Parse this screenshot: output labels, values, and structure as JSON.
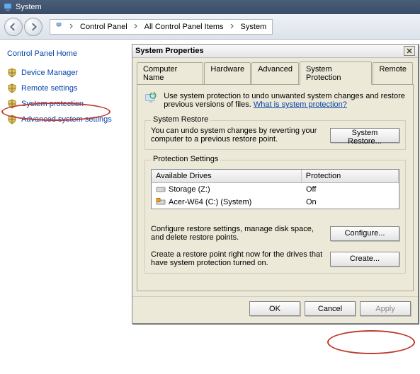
{
  "window": {
    "title": "System"
  },
  "breadcrumb": {
    "a": "Control Panel",
    "b": "All Control Panel Items",
    "c": "System"
  },
  "sidebar": {
    "home": "Control Panel Home",
    "items": [
      {
        "label": "Device Manager"
      },
      {
        "label": "Remote settings"
      },
      {
        "label": "System protection"
      },
      {
        "label": "Advanced system settings"
      }
    ]
  },
  "dialog": {
    "title": "System Properties",
    "tabs": {
      "t0": "Computer Name",
      "t1": "Hardware",
      "t2": "Advanced",
      "t3": "System Protection",
      "t4": "Remote"
    },
    "intro": {
      "text": "Use system protection to undo unwanted system changes and restore previous versions of files. ",
      "link": "What is system protection?"
    },
    "restore": {
      "legend": "System Restore",
      "text": "You can undo system changes by reverting your computer to a previous restore point.",
      "button": "System Restore..."
    },
    "protection": {
      "legend": "Protection Settings",
      "col_drives": "Available Drives",
      "col_protection": "Protection",
      "rows": [
        {
          "drive": "Storage (Z:)",
          "protection": "Off"
        },
        {
          "drive": "Acer-W64 (C:) (System)",
          "protection": "On"
        }
      ],
      "configure_text": "Configure restore settings, manage disk space, and delete restore points.",
      "configure_btn": "Configure...",
      "create_text": "Create a restore point right now for the drives that have system protection turned on.",
      "create_btn": "Create..."
    },
    "buttons": {
      "ok": "OK",
      "cancel": "Cancel",
      "apply": "Apply"
    }
  }
}
